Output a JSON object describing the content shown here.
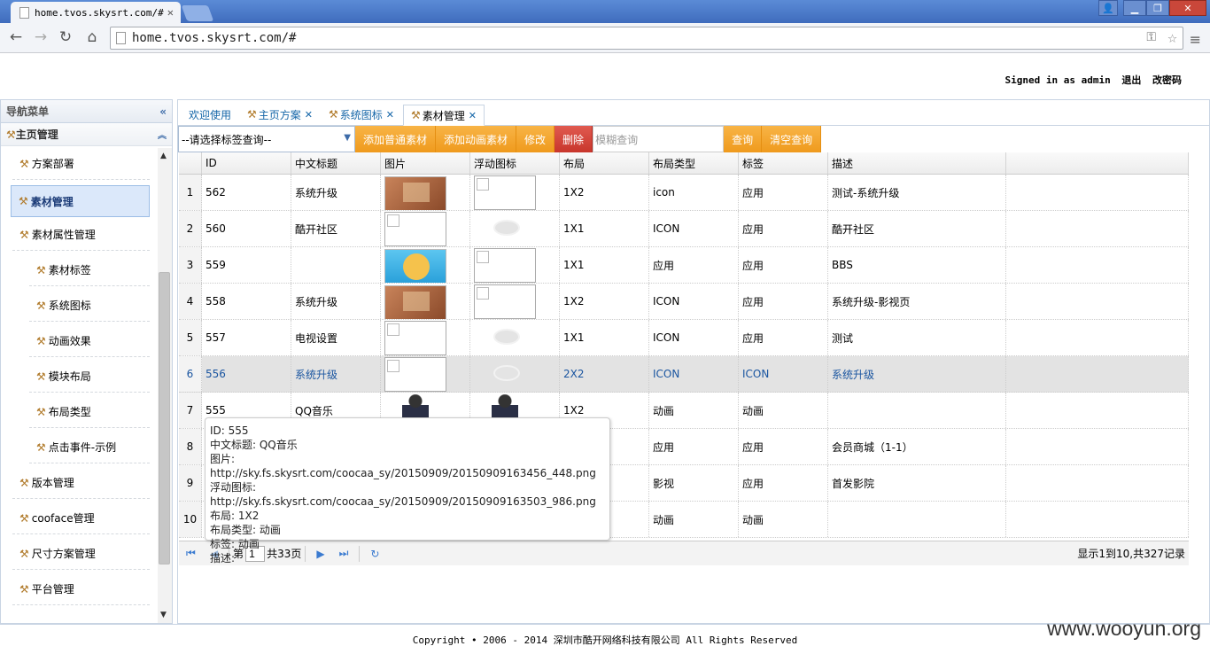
{
  "browser": {
    "tab_title": "home.tvos.skysrt.com/#",
    "address": "home.tvos.skysrt.com/#"
  },
  "header": {
    "signed_in": "Signed in as admin",
    "logout": "退出",
    "change_password": "改密码"
  },
  "sidebar": {
    "title": "导航菜单",
    "section": "主页管理",
    "items": [
      {
        "label": "方案部署",
        "level": 1
      },
      {
        "label": "素材管理",
        "level": 1,
        "active": true
      },
      {
        "label": "素材属性管理",
        "level": 1
      },
      {
        "label": "素材标签",
        "level": 2
      },
      {
        "label": "系统图标",
        "level": 2
      },
      {
        "label": "动画效果",
        "level": 2
      },
      {
        "label": "模块布局",
        "level": 2
      },
      {
        "label": "布局类型",
        "level": 2
      },
      {
        "label": "点击事件-示例",
        "level": 2
      },
      {
        "label": "版本管理",
        "level": 1
      },
      {
        "label": "cooface管理",
        "level": 1
      },
      {
        "label": "尺寸方案管理",
        "level": 1
      },
      {
        "label": "平台管理",
        "level": 1
      }
    ]
  },
  "tabs": [
    {
      "label": "欢迎使用",
      "closable": false
    },
    {
      "label": "主页方案",
      "closable": true
    },
    {
      "label": "系统图标",
      "closable": true
    },
    {
      "label": "素材管理",
      "closable": true,
      "selected": true
    }
  ],
  "toolbar": {
    "select_placeholder": "--请选择标签查询--",
    "add_normal": "添加普通素材",
    "add_anim": "添加动画素材",
    "edit": "修改",
    "delete": "删除",
    "fuzzy_placeholder": "模糊查询",
    "query": "查询",
    "clear_query": "清空查询"
  },
  "table": {
    "columns": [
      "ID",
      "中文标题",
      "图片",
      "浮动图标",
      "布局",
      "布局类型",
      "标签",
      "描述"
    ],
    "rows": [
      {
        "n": "1",
        "id": "562",
        "title": "系统升级",
        "img": "orange",
        "float": "broken",
        "layout": "1X2",
        "ltype": "icon",
        "tag": "应用",
        "desc": "测试-系统升级"
      },
      {
        "n": "2",
        "id": "560",
        "title": "酷开社区",
        "img": "broken",
        "float": "eye",
        "layout": "1X1",
        "ltype": "ICON",
        "tag": "应用",
        "desc": "酷开社区"
      },
      {
        "n": "3",
        "id": "559",
        "title": "",
        "img": "blue",
        "float": "broken",
        "layout": "1X1",
        "ltype": "应用",
        "tag": "应用",
        "desc": "BBS"
      },
      {
        "n": "4",
        "id": "558",
        "title": "系统升级",
        "img": "orange",
        "float": "broken",
        "layout": "1X2",
        "ltype": "ICON",
        "tag": "应用",
        "desc": "系统升级-影视页"
      },
      {
        "n": "5",
        "id": "557",
        "title": "电视设置",
        "img": "broken",
        "float": "eye",
        "layout": "1X1",
        "ltype": "ICON",
        "tag": "应用",
        "desc": "测试"
      },
      {
        "n": "6",
        "id": "556",
        "title": "系统升级",
        "img": "broken",
        "float": "eye",
        "layout": "2X2",
        "ltype": "ICON",
        "tag": "ICON",
        "desc": "系统升级",
        "highlight": true
      },
      {
        "n": "7",
        "id": "555",
        "title": "QQ音乐",
        "img": "person",
        "float": "person",
        "layout": "1X2",
        "ltype": "动画",
        "tag": "动画",
        "desc": ""
      },
      {
        "n": "8",
        "id": "",
        "title": "",
        "img": "",
        "float": "",
        "layout": "",
        "ltype": "应用",
        "tag": "应用",
        "desc": "会员商城（1-1）"
      },
      {
        "n": "9",
        "id": "",
        "title": "",
        "img": "",
        "float": "",
        "layout": "",
        "ltype": "影视",
        "tag": "应用",
        "desc": "首发影院"
      },
      {
        "n": "10",
        "id": "",
        "title": "",
        "img": "",
        "float": "",
        "layout": "",
        "ltype": "动画",
        "tag": "动画",
        "desc": ""
      }
    ]
  },
  "pager": {
    "page_prefix": "第",
    "page": "1",
    "page_total": "共33页",
    "summary": "显示1到10,共327记录"
  },
  "tooltip": {
    "lines": [
      "ID: 555",
      "中文标题: QQ音乐",
      "图片: http://sky.fs.skysrt.com/coocaa_sy/20150909/20150909163456_448.png",
      "浮动图标: http://sky.fs.skysrt.com/coocaa_sy/20150909/20150909163503_986.png",
      "布局: 1X2",
      "布局类型: 动画",
      "标签: 动画",
      "描述: "
    ]
  },
  "footer": "Copyright • 2006 - 2014 深圳市酷开网络科技有限公司 All Rights Reserved",
  "watermark": "www.wooyun.org"
}
